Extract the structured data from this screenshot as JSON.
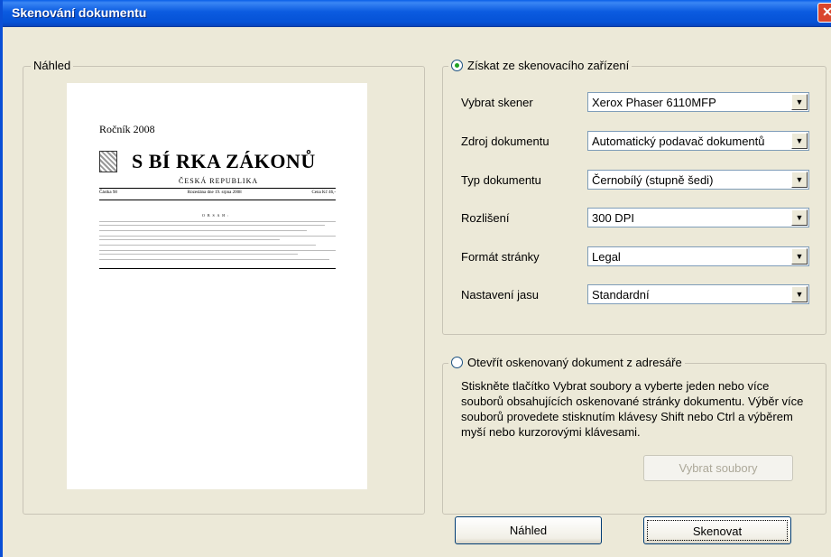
{
  "window": {
    "title": "Skenování dokumentu",
    "close_glyph": "✕"
  },
  "preview": {
    "legend": "Náhled",
    "document": {
      "rocnik": "Ročník 2008",
      "title": "S BÍ RKA ZÁKONŮ",
      "subtitle": "ČESKÁ REPUBLIKA",
      "castka": "Částka 98",
      "rozeslana": "Rozeslána dne 19. srpna 2008",
      "cena": "Cena Kč 46,-",
      "obsah": "O B S A H :"
    }
  },
  "scan_source": {
    "legend": "Získat ze skenovacího zařízení",
    "selected": true,
    "rows": [
      {
        "label": "Vybrat skener",
        "value": "Xerox Phaser 6110MFP"
      },
      {
        "label": "Zdroj dokumentu",
        "value": "Automatický podavač dokumentů"
      },
      {
        "label": "Typ dokumentu",
        "value": "Černobílý (stupně šedi)"
      },
      {
        "label": "Rozlišení",
        "value": "300 DPI"
      },
      {
        "label": "Formát stránky",
        "value": "Legal"
      },
      {
        "label": "Nastavení jasu",
        "value": "Standardní"
      }
    ]
  },
  "open_source": {
    "legend": "Otevřít oskenovaný dokument z adresáře",
    "selected": false,
    "description": "Stiskněte tlačítko Vybrat soubory a vyberte jeden nebo více souborů obsahujících oskenované stránky dokumentu. Výběr více souborů provedete stisknutím klávesy Shift nebo Ctrl a výběrem myší nebo kurzorovými klávesami.",
    "browse_label": "Vybrat soubory",
    "browse_enabled": false
  },
  "buttons": {
    "preview_label": "Náhled",
    "scan_label": "Skenovat"
  },
  "colors": {
    "titlebar": "#0b5be0",
    "dialog_bg": "#ece9d8",
    "close": "#d9462d",
    "radio_dot": "#21a121"
  }
}
